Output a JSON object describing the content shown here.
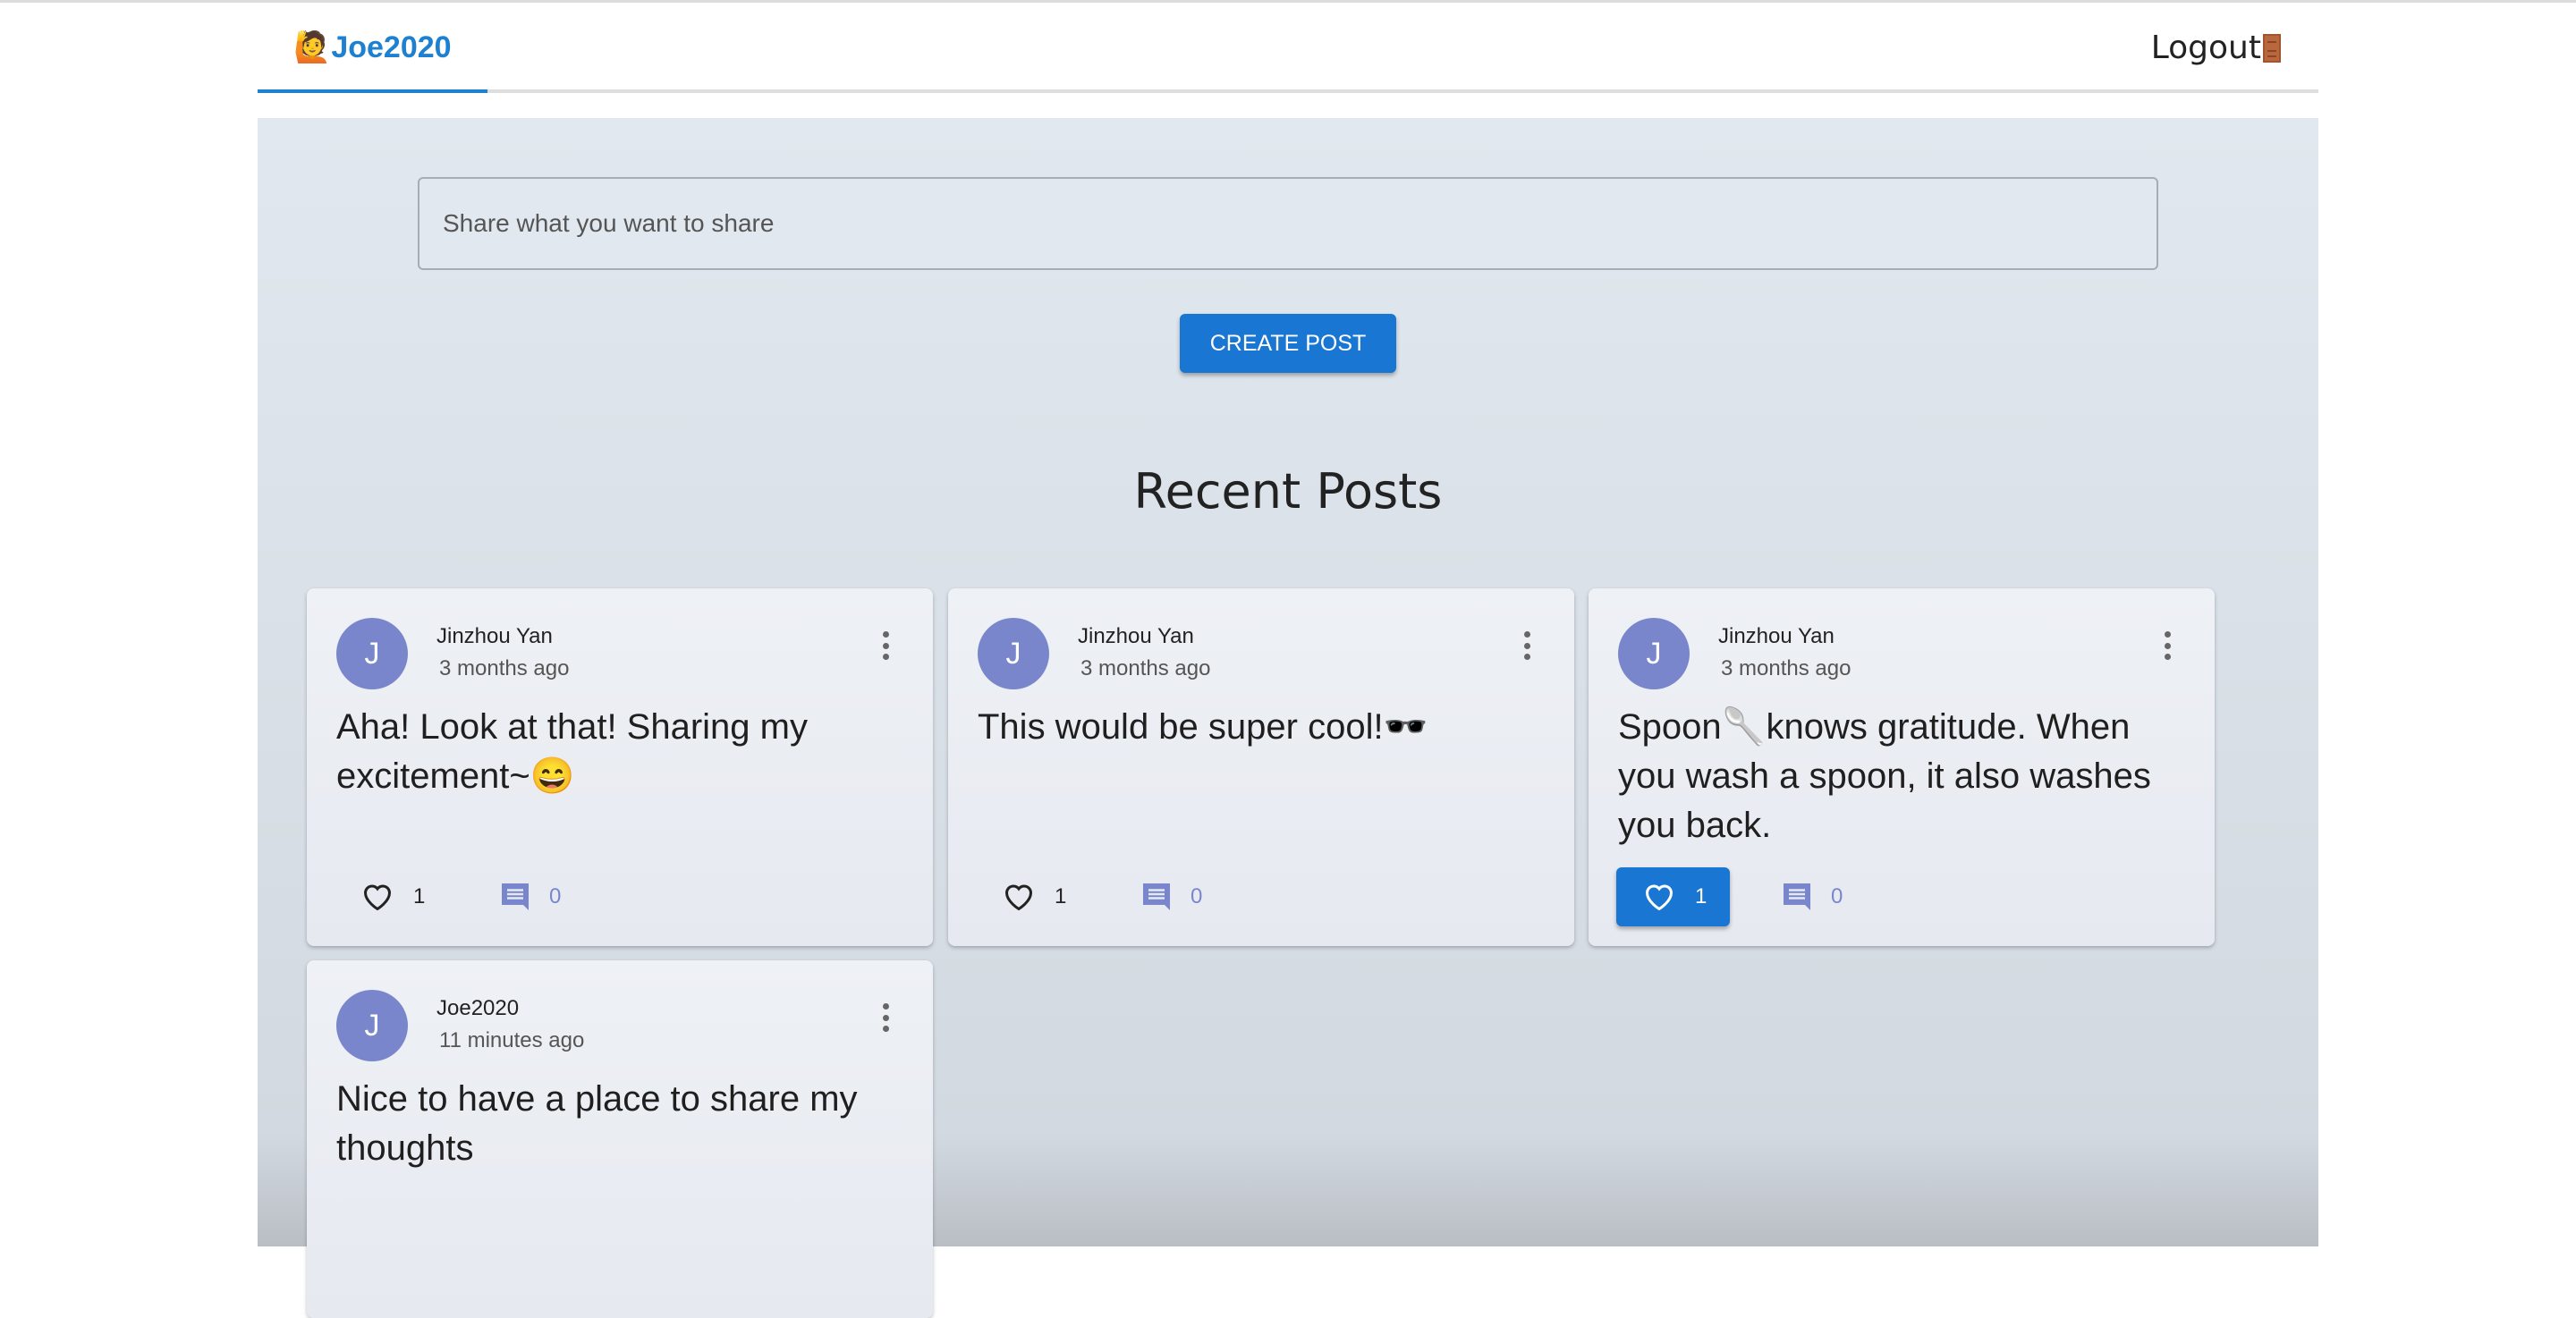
{
  "header": {
    "brand": "Joe2020",
    "brand_emoji": "🙋",
    "logout_label": "Logout"
  },
  "composer": {
    "placeholder": "Share what you want to share",
    "create_label": "CREATE POST"
  },
  "section_title": "Recent Posts",
  "colors": {
    "primary": "#1976d2",
    "avatar": "#7986cb",
    "brand": "#1e80d0"
  },
  "posts": [
    {
      "initial": "J",
      "author": "Jinzhou Yan",
      "time": "3 months ago",
      "body": "Aha! Look at that! Sharing my excitement~😄",
      "likes": "1",
      "comments": "0",
      "liked": false
    },
    {
      "initial": "J",
      "author": "Jinzhou Yan",
      "time": "3 months ago",
      "body": "This would be super cool!🕶️",
      "likes": "1",
      "comments": "0",
      "liked": false
    },
    {
      "initial": "J",
      "author": "Jinzhou Yan",
      "time": "3 months ago",
      "body": "Spoon🥄knows gratitude. When you wash a spoon, it also washes you back.",
      "likes": "1",
      "comments": "0",
      "liked": true
    },
    {
      "initial": "J",
      "author": "Joe2020",
      "time": "11 minutes ago",
      "body": "Nice to have a place to share my thoughts"
    }
  ]
}
